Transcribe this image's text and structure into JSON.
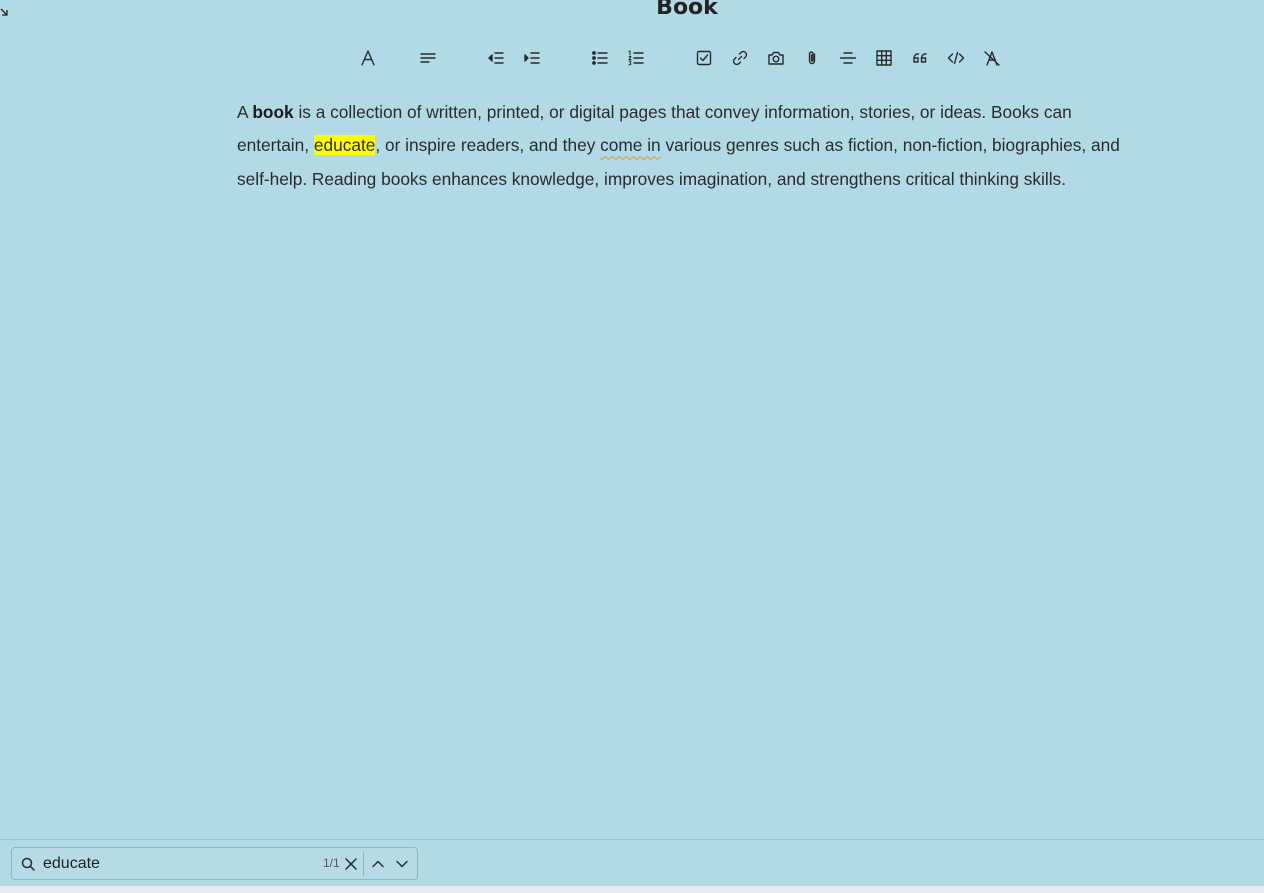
{
  "note": {
    "title": "Book",
    "paragraph": {
      "t1": "A ",
      "bold_word": "book",
      "t2": " is a collection of written, printed, or digital pages that convey information, stories, or ideas. Books can entertain, ",
      "highlight": "educate",
      "t3": ", or inspire readers, and they ",
      "flagged": "come in",
      "t4": " various genres such as fiction, non-fiction, biographies, and self-help. Reading books enhances knowledge, improves imagination, and strengthens critical thinking skills."
    }
  },
  "toolbar": {
    "buttons": [
      {
        "name": "text-style-icon"
      },
      {
        "name": "align-icon"
      },
      {
        "name": "outdent-icon"
      },
      {
        "name": "indent-icon"
      },
      {
        "name": "bulleted-list-icon"
      },
      {
        "name": "numbered-list-icon"
      },
      {
        "name": "checklist-icon"
      },
      {
        "name": "link-icon"
      },
      {
        "name": "camera-icon"
      },
      {
        "name": "attachment-icon"
      },
      {
        "name": "horizontal-rule-icon"
      },
      {
        "name": "table-icon"
      },
      {
        "name": "quote-icon"
      },
      {
        "name": "code-icon"
      },
      {
        "name": "clear-formatting-icon"
      }
    ]
  },
  "find": {
    "query": "educate",
    "count": "1/1"
  },
  "colors": {
    "background": "#b2d9e6",
    "highlight": "#ffff00",
    "spell_underline": "#d99a1a"
  }
}
